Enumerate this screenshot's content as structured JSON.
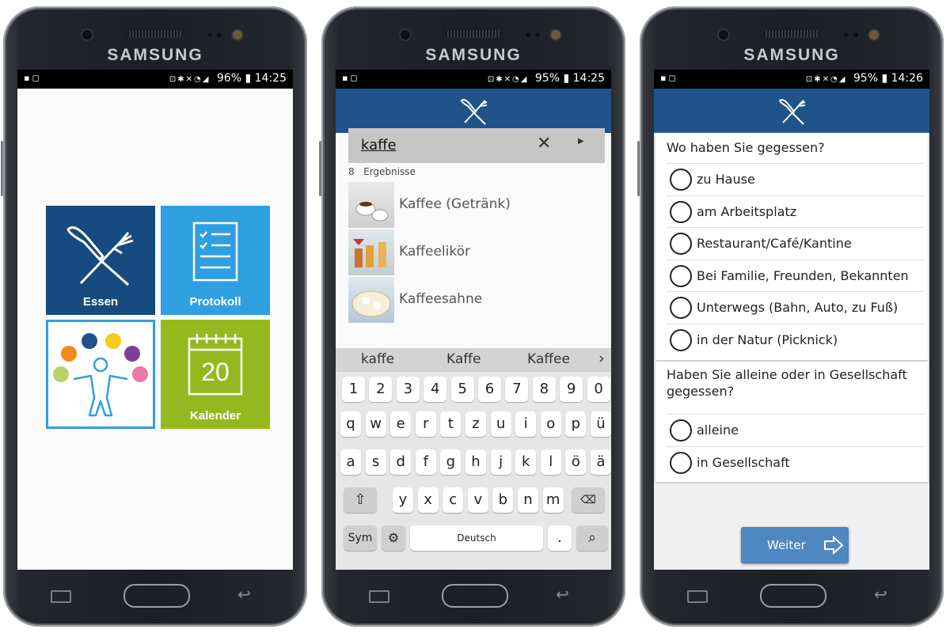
{
  "brand": "SAMSUNG",
  "colors": {
    "appbar": "#1f5389",
    "essen": "#174a7e",
    "protokoll": "#2f9fe0",
    "kalender": "#94b91f",
    "weiter": "#4f87c0"
  },
  "phones": [
    {
      "status": {
        "battery": "96%",
        "time": "14:25"
      },
      "tiles": {
        "essen": "Essen",
        "protokoll": "Protokoll",
        "kalender_day": "20",
        "kalender": "Kalender"
      }
    },
    {
      "status": {
        "battery": "95%",
        "time": "14:25"
      },
      "search": {
        "query": "kaffe",
        "results_count": "8",
        "results_label": "Ergebnisse"
      },
      "results": [
        "Kaffee (Getränk)",
        "Kaffeelikör",
        "Kaffeesahne"
      ],
      "suggestions": [
        "kaffe",
        "Kaffe",
        "Kaffee"
      ],
      "keyboard": {
        "row0": [
          "1",
          "2",
          "3",
          "4",
          "5",
          "6",
          "7",
          "8",
          "9",
          "0"
        ],
        "row1": [
          "q",
          "w",
          "e",
          "r",
          "t",
          "z",
          "u",
          "i",
          "o",
          "p",
          "ü"
        ],
        "row2": [
          "a",
          "s",
          "d",
          "f",
          "g",
          "h",
          "j",
          "k",
          "l",
          "ö",
          "ä"
        ],
        "row3": [
          "y",
          "x",
          "c",
          "v",
          "b",
          "n",
          "m"
        ],
        "sym": "Sym",
        "space": "Deutsch",
        "period": "."
      }
    },
    {
      "status": {
        "battery": "95%",
        "time": "14:26"
      },
      "q1": {
        "title": "Wo haben Sie gegessen?",
        "options": [
          "zu Hause",
          "am Arbeitsplatz",
          "Restaurant/Café/Kantine",
          "Bei Familie, Freunden, Bekannten",
          "Unterwegs (Bahn, Auto, zu Fuß)",
          "in der Natur (Picknick)"
        ]
      },
      "q2": {
        "title": "Haben Sie alleine oder in Gesellschaft gegessen?",
        "options": [
          "alleine",
          "in Gesellschaft"
        ]
      },
      "next": "Weiter"
    }
  ]
}
